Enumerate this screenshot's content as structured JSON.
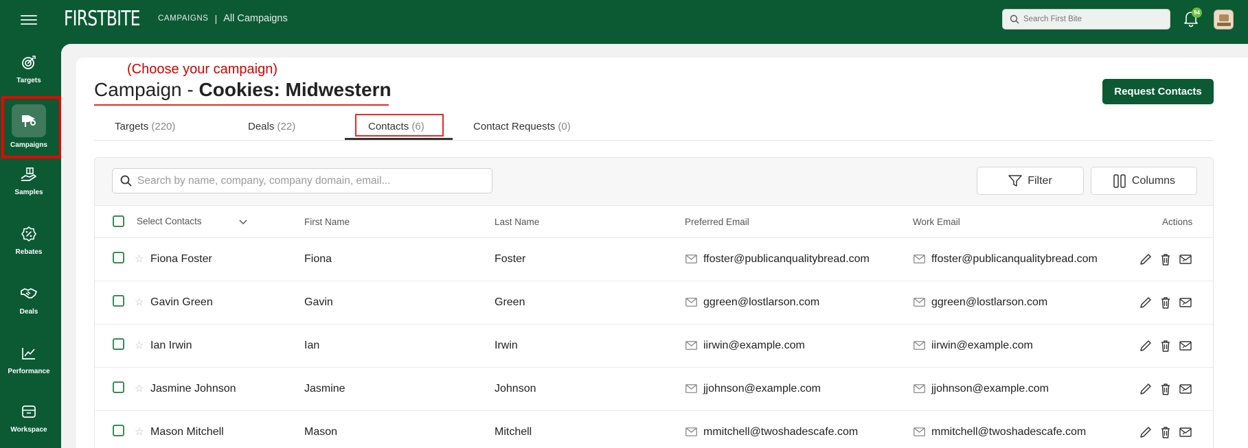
{
  "brand": {
    "name": "FIRSTBITE"
  },
  "breadcrumb": {
    "section": "CAMPAIGNS",
    "separator": "|",
    "current": "All Campaigns"
  },
  "top_search": {
    "placeholder": "Search First Bite"
  },
  "notifications": {
    "count": "94"
  },
  "sidebar": {
    "items": [
      {
        "label": "Targets",
        "icon": "target-icon"
      },
      {
        "label": "Campaigns",
        "icon": "megaphone-icon",
        "active": true
      },
      {
        "label": "Samples",
        "icon": "hand-gift-icon"
      },
      {
        "label": "Rebates",
        "icon": "percent-badge-icon"
      },
      {
        "label": "Deals",
        "icon": "handshake-icon"
      },
      {
        "label": "Performance",
        "icon": "chart-line-icon"
      },
      {
        "label": "Workspace",
        "icon": "archive-box-icon"
      }
    ]
  },
  "annotation": "(Choose your campaign)",
  "page": {
    "title_prefix": "Campaign - ",
    "title_name": "Cookies: Midwestern",
    "request_button": "Request Contacts"
  },
  "tabs": [
    {
      "label": "Targets",
      "count": "(220)"
    },
    {
      "label": "Deals",
      "count": "(22)"
    },
    {
      "label": "Contacts",
      "count": "(6)",
      "active": true
    },
    {
      "label": "Contact Requests",
      "count": "(0)"
    }
  ],
  "grid": {
    "search_placeholder": "Search by name, company, company domain, email...",
    "filter_label": "Filter",
    "columns_label": "Columns",
    "headers": {
      "select": "Select Contacts",
      "first_name": "First Name",
      "last_name": "Last Name",
      "preferred_email": "Preferred Email",
      "work_email": "Work Email",
      "actions": "Actions"
    },
    "rows": [
      {
        "name": "Fiona Foster",
        "first": "Fiona",
        "last": "Foster",
        "preferred": "ffoster@publicanqualitybread.com",
        "work": "ffoster@publicanqualitybread.com"
      },
      {
        "name": "Gavin Green",
        "first": "Gavin",
        "last": "Green",
        "preferred": "ggreen@lostlarson.com",
        "work": "ggreen@lostlarson.com"
      },
      {
        "name": "Ian Irwin",
        "first": "Ian",
        "last": "Irwin",
        "preferred": "iirwin@example.com",
        "work": "iirwin@example.com"
      },
      {
        "name": "Jasmine Johnson",
        "first": "Jasmine",
        "last": "Johnson",
        "preferred": "jjohnson@example.com",
        "work": "jjohnson@example.com"
      },
      {
        "name": "Mason Mitchell",
        "first": "Mason",
        "last": "Mitchell",
        "preferred": "mmitchell@twoshadescafe.com",
        "work": "mmitchell@twoshadescafe.com"
      }
    ]
  },
  "colors": {
    "brand_green": "#0c5a34",
    "annotation_red": "#d10000",
    "checkbox_green": "#3a8a5a"
  }
}
